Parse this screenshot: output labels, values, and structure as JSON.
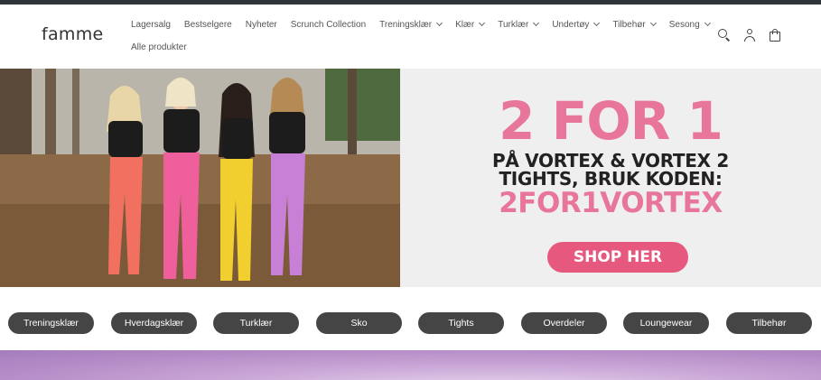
{
  "header": {
    "logo": "famme",
    "nav_row1": [
      {
        "label": "Lagersalg",
        "dropdown": false
      },
      {
        "label": "Bestselgere",
        "dropdown": false
      },
      {
        "label": "Nyheter",
        "dropdown": false
      },
      {
        "label": "Scrunch Collection",
        "dropdown": false
      },
      {
        "label": "Treningsklær",
        "dropdown": true
      },
      {
        "label": "Klær",
        "dropdown": true
      },
      {
        "label": "Turklær",
        "dropdown": true
      },
      {
        "label": "Undertøy",
        "dropdown": true
      },
      {
        "label": "Tilbehør",
        "dropdown": true
      },
      {
        "label": "Sesong",
        "dropdown": true
      }
    ],
    "nav_row2": [
      {
        "label": "Alle produkter",
        "dropdown": false
      }
    ],
    "icons": [
      "search-icon",
      "account-icon",
      "cart-icon"
    ]
  },
  "hero": {
    "promo_big": "2 FOR 1",
    "promo_line1": "PÅ VORTEX & VORTEX 2",
    "promo_line2": "TIGHTS, BRUK KODEN:",
    "promo_code": "2FOR1VORTEX",
    "cta": "SHOP HER",
    "colors": {
      "pink": "#e8769a",
      "button": "#e7587f"
    }
  },
  "categories": [
    "Treningsklær",
    "Hverdagsklær",
    "Turklær",
    "Sko",
    "Tights",
    "Overdeler",
    "Loungewear",
    "Tilbehør"
  ]
}
